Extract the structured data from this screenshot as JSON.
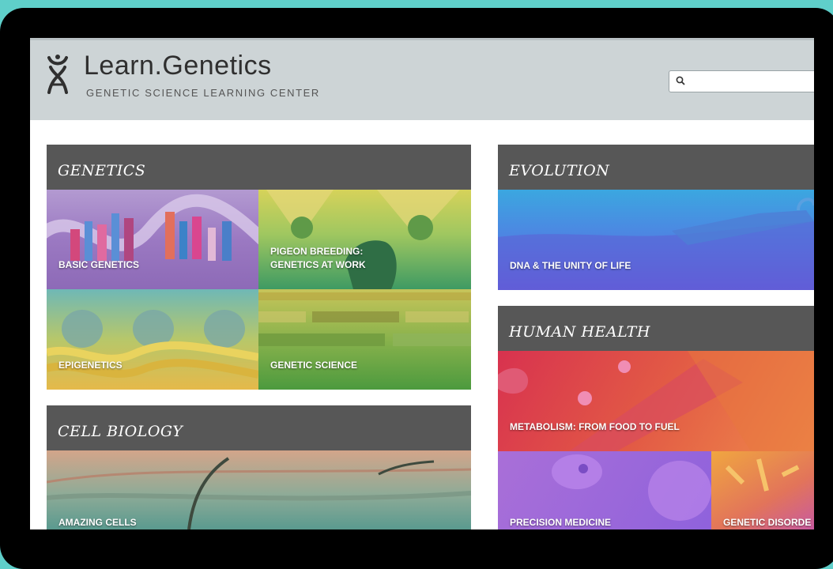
{
  "header": {
    "site_title": "Learn.Genetics",
    "site_subtitle": "GENETIC SCIENCE LEARNING CENTER",
    "search_placeholder": ""
  },
  "sections": {
    "genetics": {
      "title": "GENETICS",
      "tiles": [
        {
          "label": "BASIC GENETICS"
        },
        {
          "label_line1": "PIGEON BREEDING:",
          "label_line2": "GENETICS AT WORK"
        },
        {
          "label": "EPIGENETICS"
        },
        {
          "label": "GENETIC SCIENCE"
        }
      ]
    },
    "evolution": {
      "title": "EVOLUTION",
      "tiles": [
        {
          "label": "DNA & THE UNITY OF LIFE"
        }
      ]
    },
    "human_health": {
      "title": "HUMAN HEALTH",
      "tiles": [
        {
          "label": "METABOLISM: FROM FOOD TO FUEL"
        },
        {
          "label": "PRECISION MEDICINE"
        },
        {
          "label": "GENETIC DISORDE"
        }
      ]
    },
    "cell_biology": {
      "title": "CELL BIOLOGY",
      "tiles": [
        {
          "label": "AMAZING CELLS"
        }
      ]
    }
  },
  "colors": {
    "page_background": "#5fcfca",
    "device_bezel": "#000000",
    "header_background": "#cdd4d6",
    "section_header": "#575757"
  },
  "icons": {
    "logo": "dna-helix-icon",
    "search": "magnifier-icon"
  }
}
